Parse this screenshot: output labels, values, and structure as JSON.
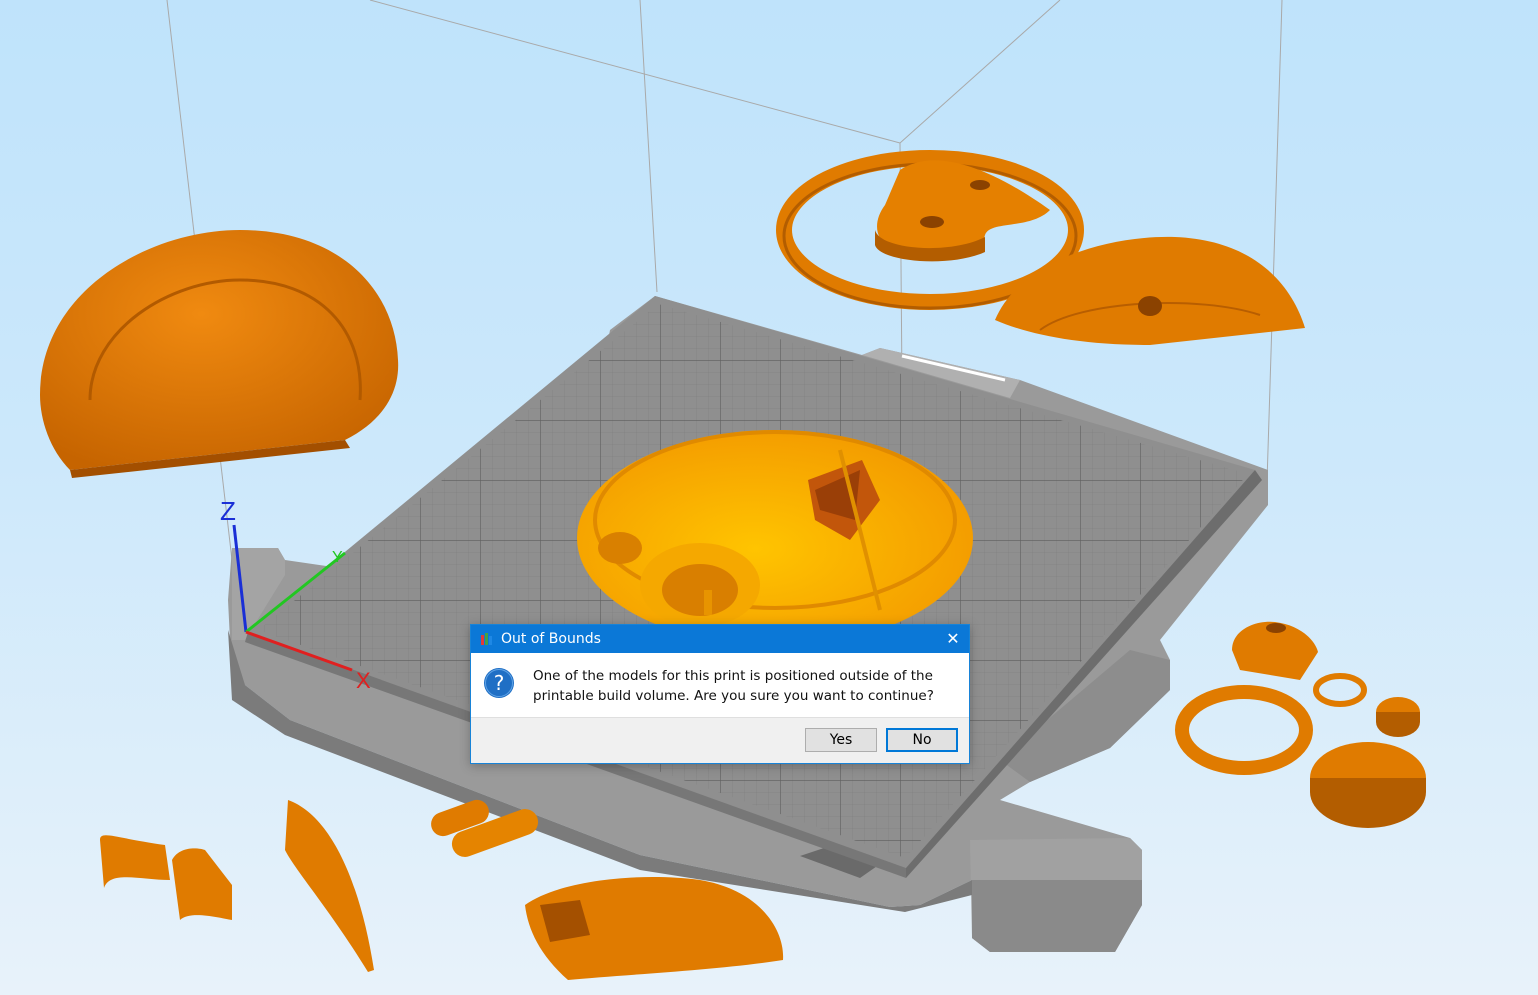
{
  "viewport": {
    "background_top": "#bfe3fb",
    "background_bottom": "#e8f2fa",
    "model_color": "#e07b00",
    "selected_model_color": "#f7a600",
    "bed_color": "#8c8c8c"
  },
  "axes": {
    "x_label": "X",
    "y_label": "Y",
    "z_label": "Z",
    "x_color": "#e02020",
    "y_color": "#22c722",
    "z_color": "#1a2fd6"
  },
  "dialog": {
    "title": "Out of Bounds",
    "icon": "question-icon",
    "message": "One of the models for this print is positioned outside of the\nprintable build volume.  Are you sure you want to continue?",
    "yes_label": "Yes",
    "no_label": "No",
    "close_label": "✕",
    "titlebar_color": "#0b78d7"
  }
}
